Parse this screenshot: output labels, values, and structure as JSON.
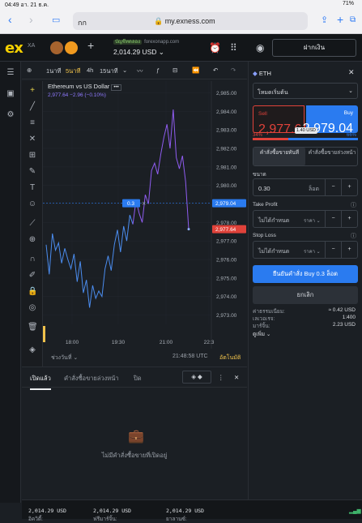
{
  "status": {
    "time": "04:49",
    "date": "อา. 21 ธ.ค.",
    "battery": "71%"
  },
  "browser": {
    "tab_label": "กก",
    "url": "my.exness.com"
  },
  "top": {
    "demo_label": "บัญชีทดลอง",
    "server": "forexonapp.com",
    "balance": "2,014.29 USD",
    "deposit_label": "ฝากเงิน"
  },
  "toolbar": {
    "tf1": "1นาที",
    "tf5": "5นาที",
    "tf4h": "4h",
    "tf15": "15นาที"
  },
  "chart": {
    "title": "Ethereum vs US Dollar",
    "sub": "2,977.64  −2.96 (−0.10%)",
    "y_ticks": [
      "2,985.00",
      "2,984.00",
      "2,983.00",
      "2,982.00",
      "2,981.00",
      "2,980.00",
      "2,979.00",
      "2,978.00",
      "2,977.00",
      "2,976.00",
      "2,975.00",
      "2,974.00",
      "2,973.00"
    ],
    "x_ticks": [
      "18:00",
      "19:30",
      "21:00",
      "22:3"
    ],
    "ask_tag": "2,979.04",
    "bid_tag": "2,977.64",
    "pos_volume": "0.3",
    "range_label": "ช่วงวันที่",
    "clock": "21:48:58 UTC",
    "auto_label": "อัตโนมัติ"
  },
  "chart_data": {
    "type": "line",
    "title": "Ethereum vs US Dollar",
    "ylim": [
      2972.5,
      2985.5
    ],
    "x_ticks": [
      "18:00",
      "19:30",
      "21:00",
      "22:3"
    ],
    "series": [
      {
        "name": "ETHUSD",
        "values": [
          2976.8,
          2975.2,
          2977.4,
          2976.5,
          2976.9,
          2975.8,
          2976.6,
          2976.0,
          2975.5,
          2976.3,
          2974.8,
          2975.9,
          2974.2,
          2974.9,
          2973.4,
          2974.6,
          2973.9,
          2974.3,
          2974.0,
          2975.5,
          2976.2,
          2975.4,
          2976.8,
          2977.6,
          2976.4,
          2977.8,
          2977.0,
          2978.4,
          2977.9,
          2979.2,
          2978.5,
          2978.0,
          2979.5,
          2979.0,
          2980.8,
          2981.2,
          2980.6,
          2981.7,
          2982.6,
          2983.3,
          2982.0,
          2984.1,
          2981.5,
          2980.9,
          2981.6,
          2980.2,
          2977.64
        ]
      }
    ]
  },
  "order": {
    "symbol": "ETH",
    "mode": "โหมดเริ่มต้น",
    "sell_label": "Sell",
    "sell_price": "2,977.64",
    "buy_label": "Buy",
    "buy_price": "2,979.04",
    "spread": "1.40 USD",
    "sell_pct": "34%",
    "buy_pct": "66%",
    "market_tab": "คำสั่งซื้อขายทันที",
    "pending_tab": "คำสั่งซื้อขายล่วงหน้า",
    "volume_label": "ขนาด",
    "volume": "0.30",
    "volume_unit": "ล็อต",
    "tp_label": "Take Profit",
    "tp_value": "ไม่ได้กำหนด",
    "sl_label": "Stop Loss",
    "sl_value": "ไม่ได้กำหนด",
    "price_unit": "ราคา",
    "confirm": "ยืนยันคำสั่ง Buy 0.3 ล็อต",
    "cancel": "ยกเลิก",
    "fees_label": "ค่าธรรมเนียม:",
    "fees": "≈ 0.42 USD",
    "leverage_label": "เลเวอเรจ:",
    "leverage": "1:400",
    "margin_label": "มาร์จิ้น:",
    "margin": "2.23 USD",
    "more": "ดูเพิ่ม"
  },
  "positions": {
    "tab_open": "เปิดแล้ว",
    "tab_pending": "คำสั่งซื้อขายล่วงหน้า",
    "tab_closed": "ปิด",
    "empty": "ไม่มีคำสั่งซื้อขายที่เปิดอยู่"
  },
  "footer": {
    "equity_label": "อิควิตี้:",
    "equity": "2,014.29 USD",
    "free_margin_label": "ฟรีมาร์จิ้น:",
    "free_margin": "2,014.29 USD",
    "balance_label": "ยาลานซ์:",
    "balance": "2,014.29 USD"
  }
}
